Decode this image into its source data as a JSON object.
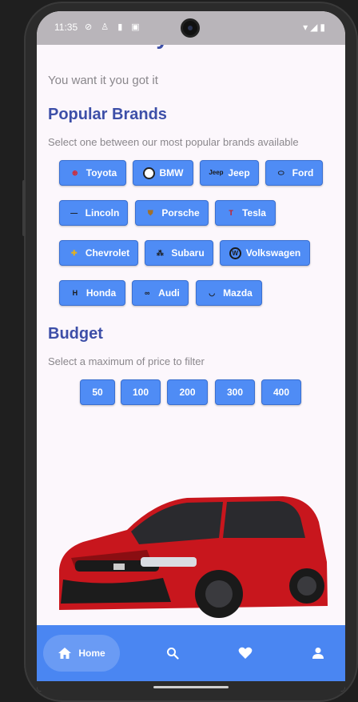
{
  "status": {
    "time": "11:35",
    "left_icons": "⊘ ♙ ▮ ▣",
    "right_icons": "▾◢▮"
  },
  "header": {
    "title": "Drive in style",
    "subtitle": "You want it you got it"
  },
  "brands": {
    "heading": "Popular Brands",
    "hint": "Select one between our most popular brands available",
    "items": [
      {
        "label": "Toyota",
        "icon": "toyota-logo-icon",
        "glyph": "⊛"
      },
      {
        "label": "BMW",
        "icon": "bmw-logo-icon",
        "glyph": "◐"
      },
      {
        "label": "Jeep",
        "icon": "jeep-logo-icon",
        "glyph": "Jeep"
      },
      {
        "label": "Ford",
        "icon": "ford-logo-icon",
        "glyph": "⬭"
      },
      {
        "label": "Lincoln",
        "icon": "lincoln-logo-icon",
        "glyph": "―"
      },
      {
        "label": "Porsche",
        "icon": "porsche-logo-icon",
        "glyph": "⛊"
      },
      {
        "label": "Tesla",
        "icon": "tesla-logo-icon",
        "glyph": "T"
      },
      {
        "label": "Chevrolet",
        "icon": "chevrolet-logo-icon",
        "glyph": "✚"
      },
      {
        "label": "Subaru",
        "icon": "subaru-logo-icon",
        "glyph": "⁂"
      },
      {
        "label": "Volkswagen",
        "icon": "volkswagen-logo-icon",
        "glyph": "W"
      },
      {
        "label": "Honda",
        "icon": "honda-logo-icon",
        "glyph": "H"
      },
      {
        "label": "Audi",
        "icon": "audi-logo-icon",
        "glyph": "∞"
      },
      {
        "label": "Mazda",
        "icon": "mazda-logo-icon",
        "glyph": "◡"
      }
    ]
  },
  "budget": {
    "heading": "Budget",
    "hint": "Select a maximum of price to filter",
    "options": [
      "50",
      "100",
      "200",
      "300",
      "400"
    ]
  },
  "nav": {
    "home_label": "Home",
    "home_icon": "home-icon",
    "search_icon": "search-icon",
    "favorites_icon": "heart-icon",
    "profile_icon": "person-icon"
  },
  "colors": {
    "accent": "#4f8cf5",
    "title": "#3d4fa8",
    "navbar": "#4a86f2",
    "car": "#c8161d"
  }
}
